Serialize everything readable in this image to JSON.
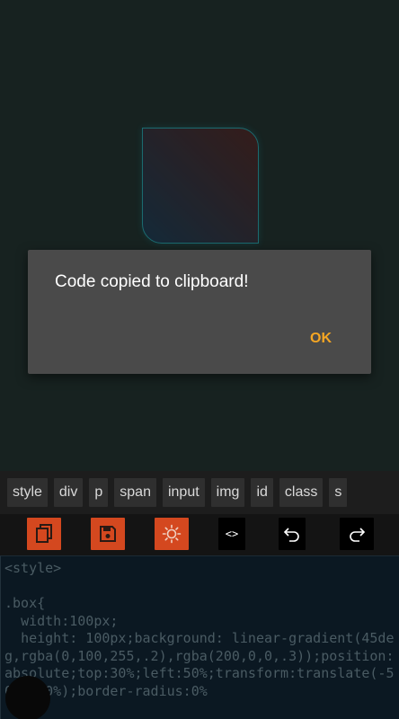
{
  "dialog": {
    "message": "Code copied to clipboard!",
    "ok_label": "OK"
  },
  "tags": [
    "style",
    "div",
    "p",
    "span",
    "input",
    "img",
    "id",
    "class",
    "s"
  ],
  "toolbar": {
    "copy_icon": "copy-icon",
    "save_icon": "save-icon",
    "brightness_icon": "brightness-icon",
    "code_label": "<>",
    "undo_icon": "undo-icon",
    "redo_icon": "redo-icon"
  },
  "editor": {
    "code": "<style>\n\n.box{\n  width:100px;\n  height: 100px;background: linear-gradient(45deg,rgba(0,100,255,.2),rgba(200,0,0,.3));position: absolute;top:30%;left:50%;transform:translate(-50%,-50%);border-radius:0%"
  },
  "colors": {
    "accent_orange": "#d4481f",
    "dialog_ok": "#f5a623",
    "box_border": "#1fa6b1"
  }
}
